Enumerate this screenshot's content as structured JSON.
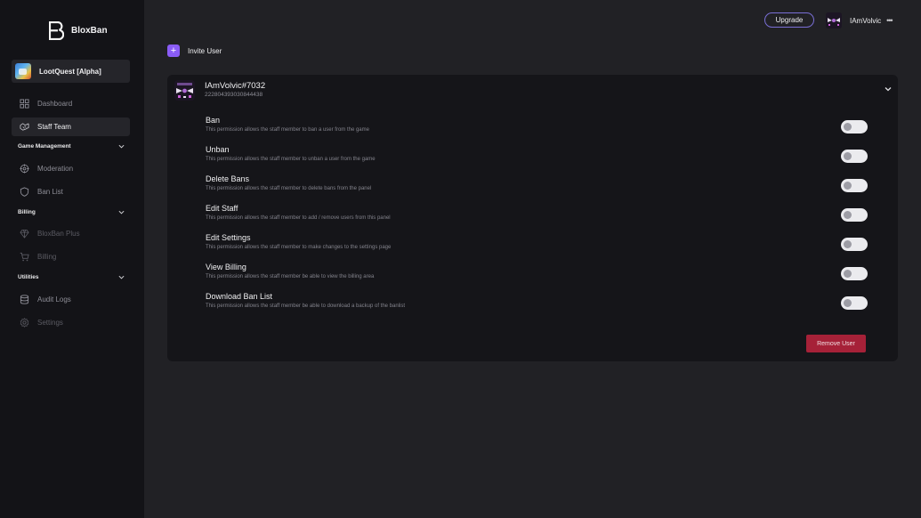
{
  "app": {
    "name": "BloxBan"
  },
  "game": {
    "name": "LootQuest [Alpha]"
  },
  "sidebar": {
    "items": [
      {
        "label": "Dashboard",
        "icon": "grid-icon"
      },
      {
        "label": "Staff Team",
        "icon": "handshake-icon"
      }
    ],
    "sections": [
      {
        "label": "Game Management",
        "items": [
          {
            "label": "Moderation",
            "icon": "crosshair-icon"
          },
          {
            "label": "Ban List",
            "icon": "shield-icon"
          }
        ]
      },
      {
        "label": "Billing",
        "items": [
          {
            "label": "BloxBan Plus",
            "icon": "diamond-icon"
          },
          {
            "label": "Billing",
            "icon": "cart-icon"
          }
        ]
      },
      {
        "label": "Utilities",
        "items": [
          {
            "label": "Audit Logs",
            "icon": "database-icon"
          },
          {
            "label": "Settings",
            "icon": "gear-icon"
          }
        ]
      }
    ]
  },
  "header": {
    "upgrade_label": "Upgrade",
    "username": "IAmVolvic",
    "more_icon": "ellipsis-icon"
  },
  "invite": {
    "label": "Invite User",
    "icon": "plus-icon"
  },
  "member": {
    "name": "IAmVolvic#7032",
    "id": "222804393030844438",
    "permissions": [
      {
        "title": "Ban",
        "description": "This permission allows the staff member to ban a user from the game",
        "enabled": false
      },
      {
        "title": "Unban",
        "description": "This permission allows the staff member to unban a user from the game",
        "enabled": false
      },
      {
        "title": "Delete Bans",
        "description": "This permission allows the staff member to delete bans from the panel",
        "enabled": false
      },
      {
        "title": "Edit Staff",
        "description": "This permission allows the staff member to add / remove users from this panel",
        "enabled": false
      },
      {
        "title": "Edit Settings",
        "description": "This permission allows the staff member to make changes to the settings page",
        "enabled": false
      },
      {
        "title": "View Billing",
        "description": "This permission allows the staff member be able to view the billing area",
        "enabled": false
      },
      {
        "title": "Download Ban List",
        "description": "This permission allows the staff member be able to download a backup of the banlist",
        "enabled": false
      }
    ],
    "remove_label": "Remove User"
  },
  "colors": {
    "accent": "#8a5cf6",
    "danger": "#a62138",
    "sidebar_bg": "#131317",
    "page_bg": "#212125",
    "card_bg": "#151519"
  }
}
